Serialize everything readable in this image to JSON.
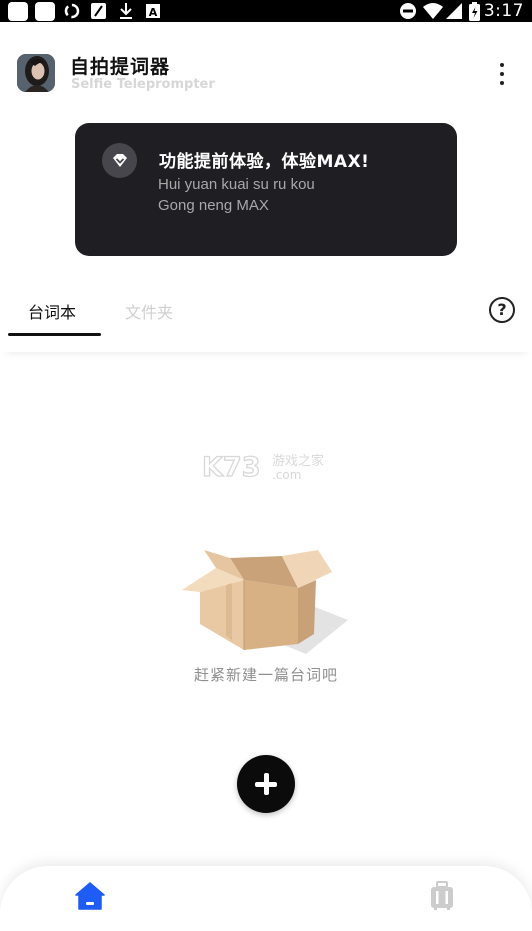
{
  "status_bar": {
    "time": "3:17",
    "icons": [
      "square-icon",
      "square-icon",
      "sync-icon",
      "edit-icon",
      "download-icon",
      "a-icon",
      "dnd-icon",
      "wifi-icon",
      "signal-icon",
      "battery-icon"
    ]
  },
  "header": {
    "title": "自拍提词器",
    "subtitle": "Selfie Teleprompter",
    "avatar_icon": "avatar"
  },
  "promo": {
    "title": "功能提前体验，体验MAX!",
    "line1": "Hui yuan kuai su ru kou",
    "line2": "Gong neng MAX",
    "icon": "diamond-icon"
  },
  "tabs": [
    {
      "label": "台词本",
      "active": true
    },
    {
      "label": "文件夹",
      "active": false
    }
  ],
  "help_icon": "?",
  "watermark": {
    "brand": "K73",
    "tag": "游戏之家",
    "domain": ".com"
  },
  "empty_state": {
    "text": "赶紧新建一篇台词吧",
    "icon": "box-icon"
  },
  "fab": {
    "icon": "plus-icon"
  },
  "bottom_nav": {
    "items": [
      {
        "icon": "home-icon",
        "active": true
      },
      {
        "icon": "suitcase-icon",
        "active": false
      }
    ]
  },
  "colors": {
    "accent": "#1d5cf5",
    "banner_bg": "#1f1f23",
    "inactive_tab": "#cfcfcf",
    "inactive_nav": "#cccccc"
  }
}
